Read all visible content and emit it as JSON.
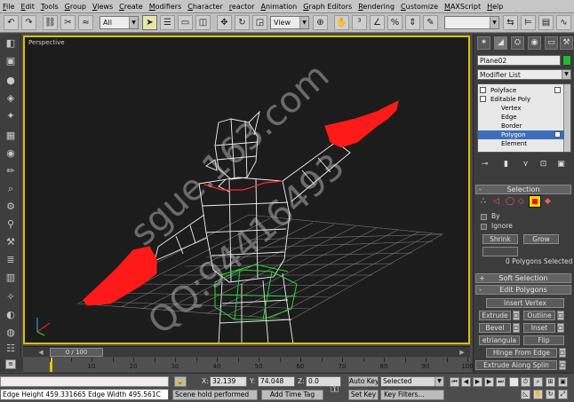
{
  "menu": [
    "File",
    "Edit",
    "Tools",
    "Group",
    "Views",
    "Create",
    "Modifiers",
    "Character",
    "reactor",
    "Animation",
    "Graph Editors",
    "Rendering",
    "Customize",
    "MAXScript",
    "Help"
  ],
  "toolbar": {
    "selection_filter": "All",
    "reference_coord": "View",
    "named_selection": ""
  },
  "viewport": {
    "label": "Perspective"
  },
  "watermark": [
    "sgue.163.com",
    "QQ:94416493"
  ],
  "time_slider": {
    "frame_display": "0 / 100",
    "ruler_labels": [
      "10",
      "20",
      "30",
      "40",
      "50",
      "60",
      "70",
      "80",
      "90",
      "100"
    ]
  },
  "status": {
    "info_line": "Edge Height 459.331665 Edge Width 495.561C",
    "prompt": "Scene hold performed",
    "add_time_tag": "Add Time Tag",
    "x_label": "X:",
    "x_value": "32.139",
    "y_label": "Y:",
    "y_value": "74.048",
    "z_label": "Z:",
    "z_value": "0.0",
    "auto_key": "Auto Key",
    "set_key": "Set Key",
    "key_mode": "Selected",
    "key_filters": "Key Filters..."
  },
  "command_panel": {
    "object_name": "Plane02",
    "modifier_list": "Modifier List",
    "stack": [
      {
        "label": "Polyface",
        "indent": 1
      },
      {
        "label": "Editable Poly",
        "indent": 1
      },
      {
        "label": "Vertex",
        "indent": 2
      },
      {
        "label": "Edge",
        "indent": 2
      },
      {
        "label": "Border",
        "indent": 2
      },
      {
        "label": "Polygon",
        "indent": 2,
        "selected": true
      },
      {
        "label": "Element",
        "indent": 2
      }
    ],
    "selection_rollout": "Selection",
    "by_label": "By",
    "ignore_label": "Ignore",
    "shrink": "Shrink",
    "grow": "Grow",
    "selection_info": "0 Polygons Selected",
    "soft_selection_rollout": "Soft Selection",
    "edit_polygons_rollout": "Edit Polygons",
    "insert_vertex": "Insert Vertex",
    "extrude": "Extrude",
    "outline": "Outline",
    "bevel": "Bevel",
    "inset": "Inset",
    "retriangulate": "etriangula",
    "flip": "Flip",
    "hinge_from_edge": "Hinge From Edge",
    "extrude_along_spline": "Extrude Along Splin"
  },
  "colors": {
    "viewport_border": "#d7c300",
    "object_color": "#1fbb2c",
    "hand_red": "#ff1a1a",
    "stack_selected": "#3c6fb9"
  }
}
